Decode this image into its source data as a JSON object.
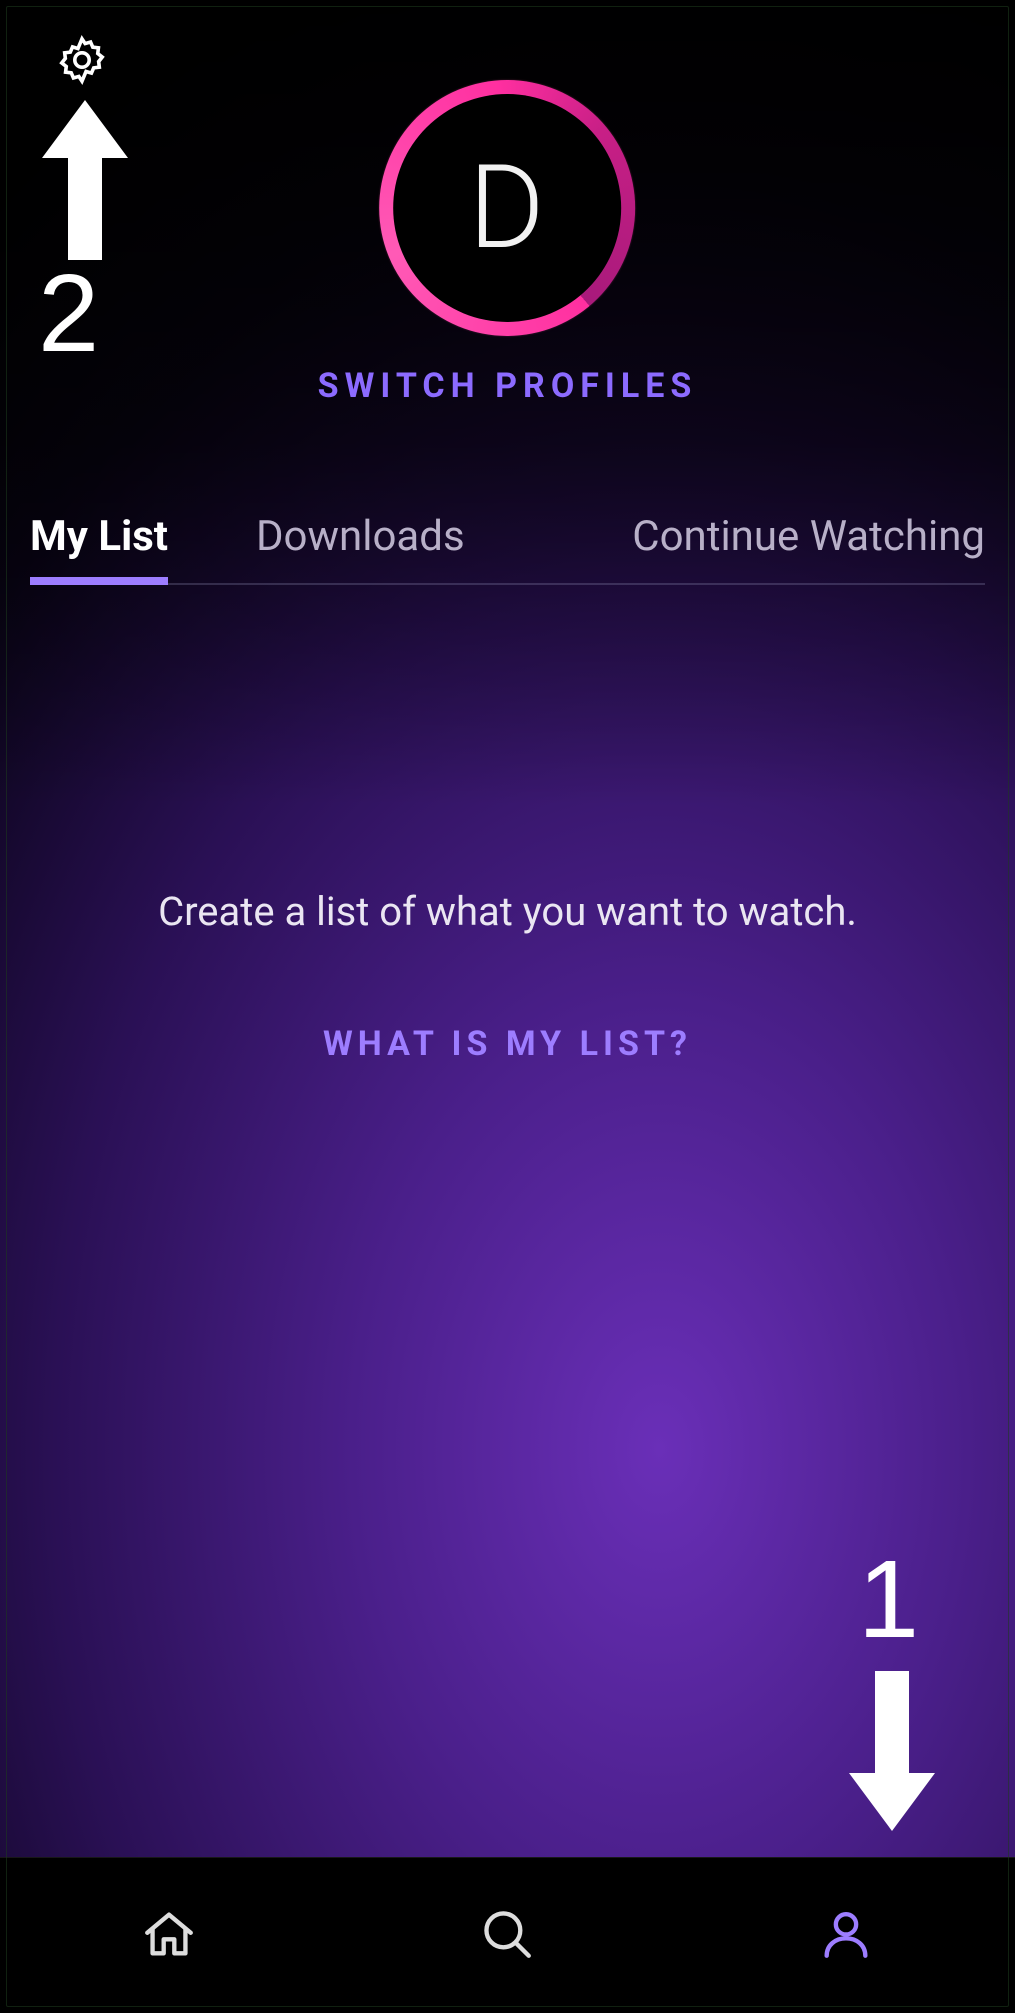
{
  "header": {
    "settings_icon": "gear-icon"
  },
  "profile": {
    "avatar_initial": "D",
    "switch_label": "SWITCH PROFILES"
  },
  "tabs": [
    {
      "label": "My List",
      "active": true
    },
    {
      "label": "Downloads",
      "active": false
    },
    {
      "label": "Continue Watching",
      "active": false
    }
  ],
  "empty_state": {
    "message": "Create a list of what you want to watch.",
    "link_label": "WHAT IS MY LIST?"
  },
  "bottom_nav": {
    "home": "home-icon",
    "search": "search-icon",
    "profile": "profile-icon"
  },
  "annotations": {
    "step1": "1",
    "step2": "2"
  },
  "colors": {
    "accent_purple": "#9d7dff",
    "avatar_ring": "#ff2fa0"
  }
}
